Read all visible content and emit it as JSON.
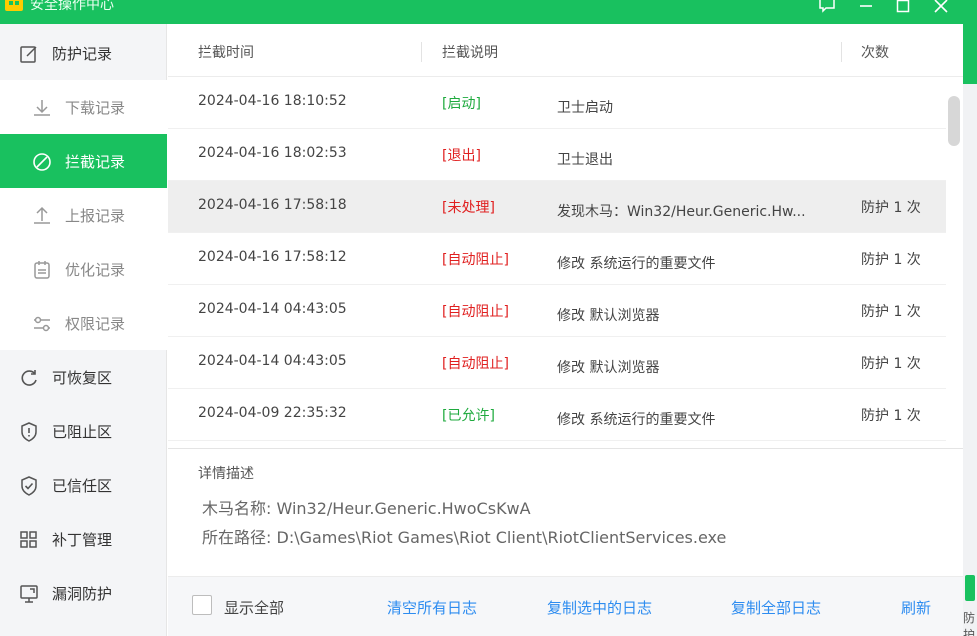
{
  "window": {
    "title": "安全操作中心",
    "right_strip_text": "防护"
  },
  "colors": {
    "accent": "#19c15f",
    "tag_green": "#1faa3e",
    "tag_red": "#e02020",
    "link": "#2d8cf0"
  },
  "sidebar": {
    "items": [
      {
        "label": "防护记录",
        "icon": "edit-icon"
      },
      {
        "label": "下载记录",
        "icon": "download-icon"
      },
      {
        "label": "拦截记录",
        "icon": "block-icon"
      },
      {
        "label": "上报记录",
        "icon": "upload-icon"
      },
      {
        "label": "优化记录",
        "icon": "clipboard-icon"
      },
      {
        "label": "权限记录",
        "icon": "sliders-icon"
      },
      {
        "label": "可恢复区",
        "icon": "restore-icon"
      },
      {
        "label": "已阻止区",
        "icon": "shield-alert-icon"
      },
      {
        "label": "已信任区",
        "icon": "shield-check-icon"
      },
      {
        "label": "补丁管理",
        "icon": "grid-icon"
      },
      {
        "label": "漏洞防护",
        "icon": "monitor-icon"
      }
    ]
  },
  "table": {
    "headers": [
      "拦截时间",
      "拦截说明",
      "次数"
    ],
    "rows": [
      {
        "time": "2024-04-16 18:10:52",
        "tag": "[启动]",
        "desc": "卫士启动",
        "count": ""
      },
      {
        "time": "2024-04-16 18:02:53",
        "tag": "[退出]",
        "desc": "卫士退出",
        "count": ""
      },
      {
        "time": "2024-04-16 17:58:18",
        "tag": "[未处理]",
        "desc": "发现木马：Win32/Heur.Generic.Hw...",
        "count": "防护 1 次"
      },
      {
        "time": "2024-04-16 17:58:12",
        "tag": "[自动阻止]",
        "desc": "修改 系统运行的重要文件",
        "count": "防护 1 次"
      },
      {
        "time": "2024-04-14 04:43:05",
        "tag": "[自动阻止]",
        "desc": "修改 默认浏览器",
        "count": "防护 1 次"
      },
      {
        "time": "2024-04-14 04:43:05",
        "tag": "[自动阻止]",
        "desc": "修改 默认浏览器",
        "count": "防护 1 次"
      },
      {
        "time": "2024-04-09 22:35:32",
        "tag": "[已允许]",
        "desc": "修改 系统运行的重要文件",
        "count": "防护 1 次"
      }
    ]
  },
  "detail": {
    "title": "详情描述",
    "trojan_label": "木马名称:",
    "trojan_value": "Win32/Heur.Generic.HwoCsKwA",
    "path_label": "所在路径:",
    "path_value": "D:\\Games\\Riot Games\\Riot Client\\RiotClientServices.exe"
  },
  "footer": {
    "show_all_label": "显示全部",
    "clear_all": "清空所有日志",
    "copy_selected": "复制选中的日志",
    "copy_all": "复制全部日志",
    "refresh": "刷新"
  }
}
